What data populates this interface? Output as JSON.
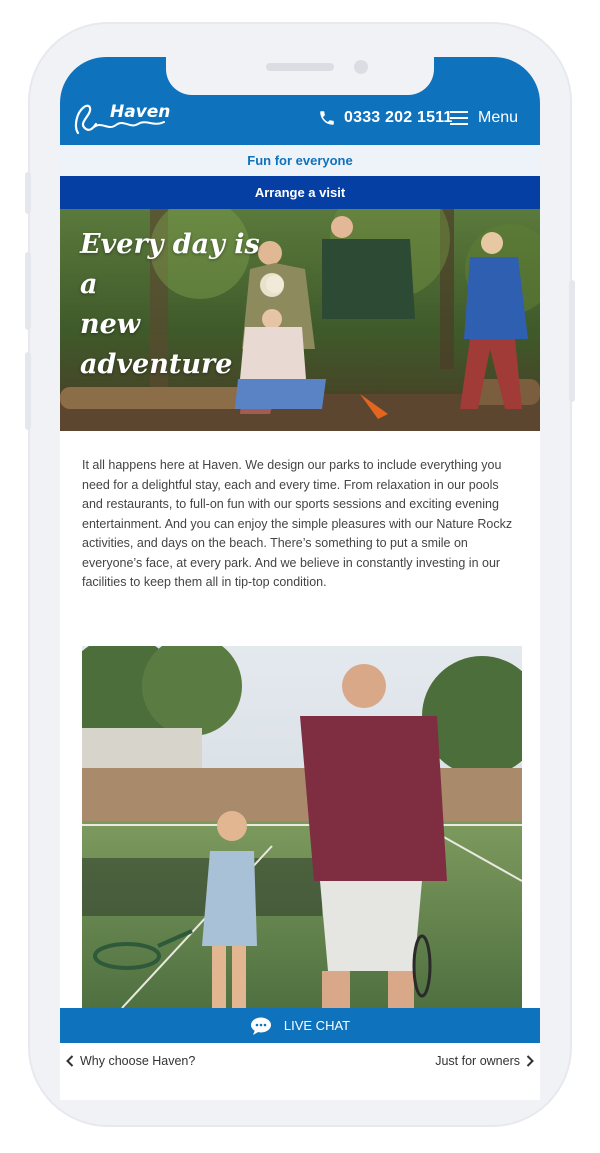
{
  "header": {
    "logo_text": "Haven",
    "phone_number": "0333 202 1511",
    "menu_label": "Menu",
    "brand_color": "#0f72bd"
  },
  "banners": {
    "fun_for_everyone": "Fun for everyone",
    "arrange_visit": "Arrange a visit",
    "visit_color": "#063fa4"
  },
  "hero": {
    "headline_line1": "Every day is a",
    "headline_line2": "new adventure"
  },
  "main": {
    "intro": "It all happens here at Haven. We design our parks to include everything you need for a delightful stay, each and every time. From relaxation in our pools and restaurants, to full-on fun with our sports sessions and exciting evening entertainment. And you can enjoy the simple pleasures with our Nature Rockz activities, and days on the beach. There’s something to put a smile on everyone’s face, at every park. And we believe in constantly investing in our facilities to keep them all in tip-top condition."
  },
  "live_chat": {
    "label": "LIVE CHAT"
  },
  "bottom_nav": {
    "prev_label": "Why choose Haven?",
    "next_label": "Just for owners"
  },
  "icons": {
    "phone": "phone-icon",
    "menu": "hamburger-menu-icon",
    "chat": "chat-bubble-icon",
    "prev": "chevron-left-icon",
    "next": "chevron-right-icon"
  }
}
